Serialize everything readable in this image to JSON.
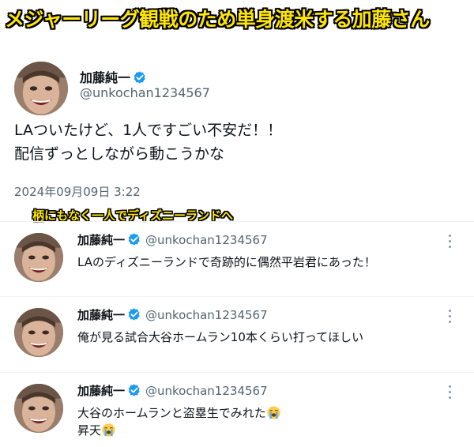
{
  "banner": {
    "text": "メジャーリーグ観戦のため単身渡米する加藤さん"
  },
  "main_tweet": {
    "display_name": "加藤純一",
    "handle": "@unkochan1234567",
    "lines": [
      "LAついたけど、1人ですごい不安だ！！",
      "配信ずっとしながら動こうかな"
    ],
    "timestamp": "2024年09月09日 3:22"
  },
  "caption": {
    "text": "柄にもなく一人でディズニーランドへ"
  },
  "replies": [
    {
      "display_name": "加藤純一",
      "handle": "@unkochan1234567",
      "lines": [
        "LAのディズニーランドで奇跡的に偶然平岩君にあった！"
      ]
    },
    {
      "display_name": "加藤純一",
      "handle": "@unkochan1234567",
      "lines": [
        "俺が見る試合大谷ホームラン10本くらい打ってほしい"
      ]
    },
    {
      "display_name": "加藤純一",
      "handle": "@unkochan1234567",
      "lines": [
        "大谷のホームランと盗塁生でみれた",
        "昇天"
      ],
      "emoji": "loudly-crying-face"
    }
  ],
  "colors": {
    "verified": "#1d9bf0",
    "handle": "#536471",
    "text": "#0f1419",
    "banner_text": "#ffe600"
  }
}
